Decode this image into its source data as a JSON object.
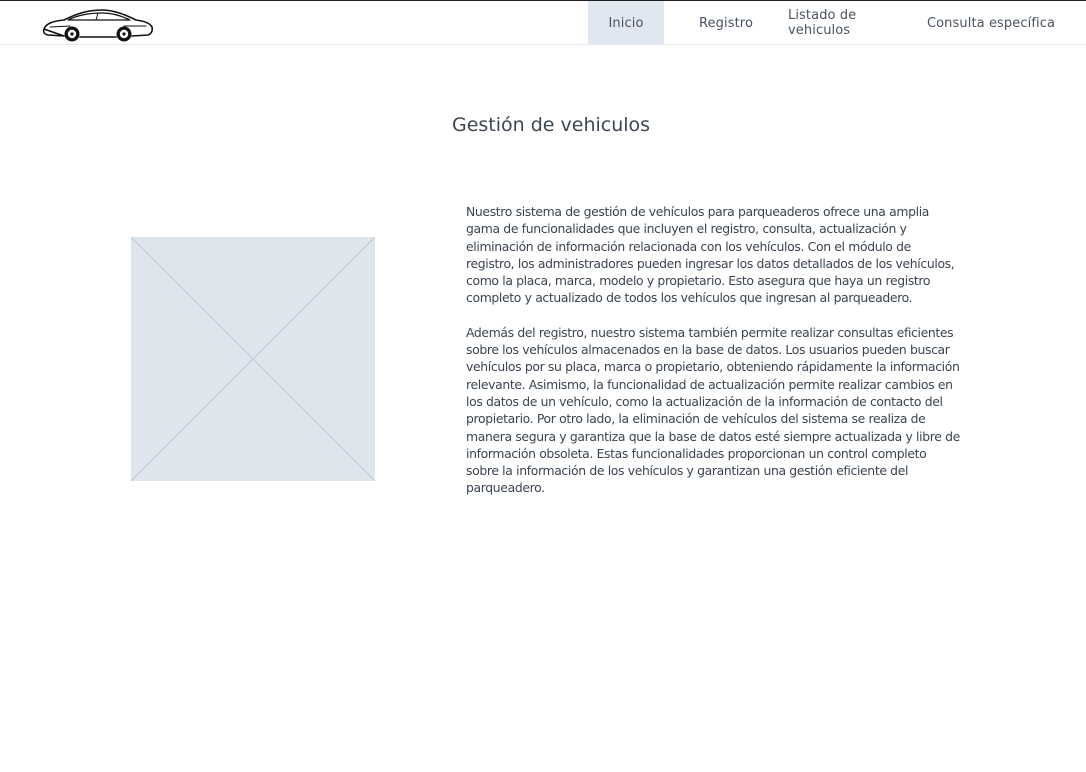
{
  "header": {
    "logo_icon": "sports-car-icon",
    "nav": {
      "inicio": "Inicio",
      "registro": "Registro",
      "listado": "Listado de vehiculos",
      "consulta": "Consulta específica"
    },
    "active_tab": "Inicio"
  },
  "main": {
    "title": "Gestión de vehiculos",
    "image_icon": "image-placeholder-icon",
    "paragraphs": [
      "Nuestro sistema de gestión de vehículos para parqueaderos ofrece una amplia gama de funcionalidades que incluyen el registro, consulta, actualización y eliminación de información relacionada con los vehículos. Con el módulo de registro, los administradores pueden ingresar los datos detallados de los vehículos, como la placa, marca, modelo y propietario. Esto asegura que haya un registro completo y actualizado de todos los vehículos que ingresan al parqueadero.",
      "Además del registro, nuestro sistema también permite realizar consultas eficientes sobre los vehículos almacenados en la base de datos. Los usuarios pueden buscar vehículos por su placa, marca o propietario, obteniendo rápidamente la información relevante. Asimismo, la funcionalidad de actualización permite realizar cambios en los datos de un vehículo, como la actualización de la información de contacto del propietario. Por otro lado, la eliminación de vehículos del sistema se realiza de manera segura y garantiza que la base de datos esté siempre actualizada y libre de información obsoleta. Estas funcionalidades proporcionan un control completo sobre la información de los vehículos y garantizan una gestión eficiente del parqueadero."
    ]
  },
  "colors": {
    "active_tab_bg": "#e1e7f0",
    "placeholder_fill": "#dfe5ed",
    "placeholder_lines": "#c3ccd8",
    "text": "#3a4450"
  }
}
